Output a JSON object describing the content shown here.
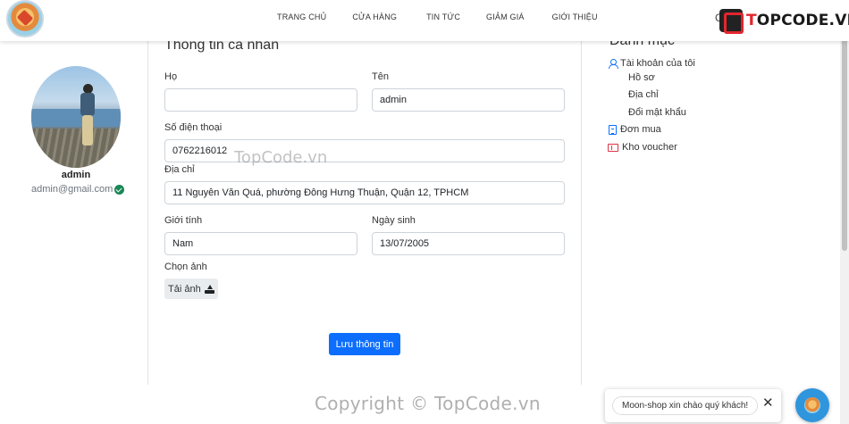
{
  "nav": {
    "links": [
      "TRANG CHỦ",
      "CỬA HÀNG",
      "TIN TỨC",
      "GIẢM GIÁ",
      "GIỚI THIỆU"
    ],
    "cart_glyph": "C"
  },
  "watermark": {
    "brand_prefix": "T",
    "brand_main": "OPCODE.VN",
    "center": "TopCode.vn",
    "footer": "Copyright © TopCode.vn"
  },
  "profile": {
    "name": "admin",
    "email": "admin@gmail.com"
  },
  "form": {
    "title": "Thông tin cá nhân",
    "last_name_label": "Họ",
    "last_name_value": "",
    "first_name_label": "Tên",
    "first_name_value": "admin",
    "phone_label": "Số điện thoại",
    "phone_value": "0762216012",
    "address_label": "Địa chỉ",
    "address_value": "11 Nguyễn Văn Quá, phường Đông Hưng Thuận, Quận 12, TPHCM",
    "gender_label": "Giới tính",
    "gender_value": "Nam",
    "dob_label": "Ngày sinh",
    "dob_value": "13/07/2005",
    "image_label": "Chọn ảnh",
    "upload_label": "Tải ảnh",
    "save_label": "Lưu thông tin"
  },
  "menu": {
    "title": "Danh mục",
    "account_label": "Tài khoản của tôi",
    "sub_items": [
      "Hồ sơ",
      "Địa chỉ",
      "Đổi mật khẩu"
    ],
    "orders_label": "Đơn mua",
    "voucher_label": "Kho voucher"
  },
  "chat": {
    "greeting": "Moon-shop xin chào quý khách!",
    "close_glyph": "✕"
  },
  "colors": {
    "primary": "#0d6efd",
    "verified": "#198754",
    "voucher": "#dc3545",
    "chat_fab": "#2f95dc"
  }
}
